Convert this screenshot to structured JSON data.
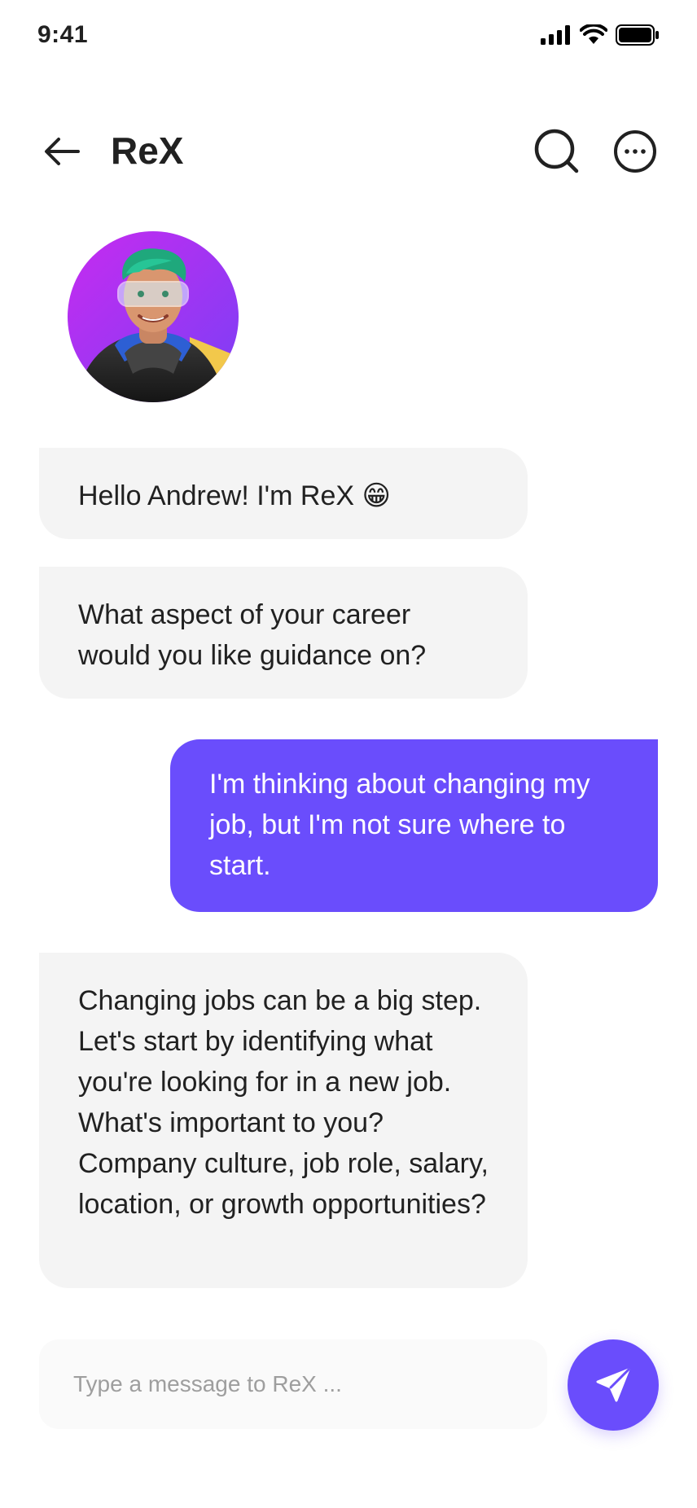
{
  "status_bar": {
    "time": "9:41"
  },
  "header": {
    "title": "ReX"
  },
  "messages": [
    {
      "sender": "bot",
      "text": "Hello Andrew! I'm ReX 😁"
    },
    {
      "sender": "bot",
      "text": "What aspect of your career would you like guidance on?"
    },
    {
      "sender": "user",
      "text": "I'm thinking about changing my job, but I'm not sure where to start."
    },
    {
      "sender": "bot",
      "text": "Changing jobs can be a big step. Let's start by identifying what you're looking for in a new job. What's important to you? Company culture, job role, salary, location, or growth opportunities?"
    }
  ],
  "composer": {
    "placeholder": "Type a message to ReX ...",
    "value": ""
  },
  "icons": {
    "back": "arrow-left-icon",
    "search": "search-icon",
    "more": "more-horizontal-icon",
    "send": "send-icon"
  },
  "colors": {
    "accent": "#6a4dfc",
    "bot_bubble": "#f4f4f4",
    "composer_bg": "#fafafa",
    "text": "#212121",
    "placeholder": "#9e9e9e"
  }
}
